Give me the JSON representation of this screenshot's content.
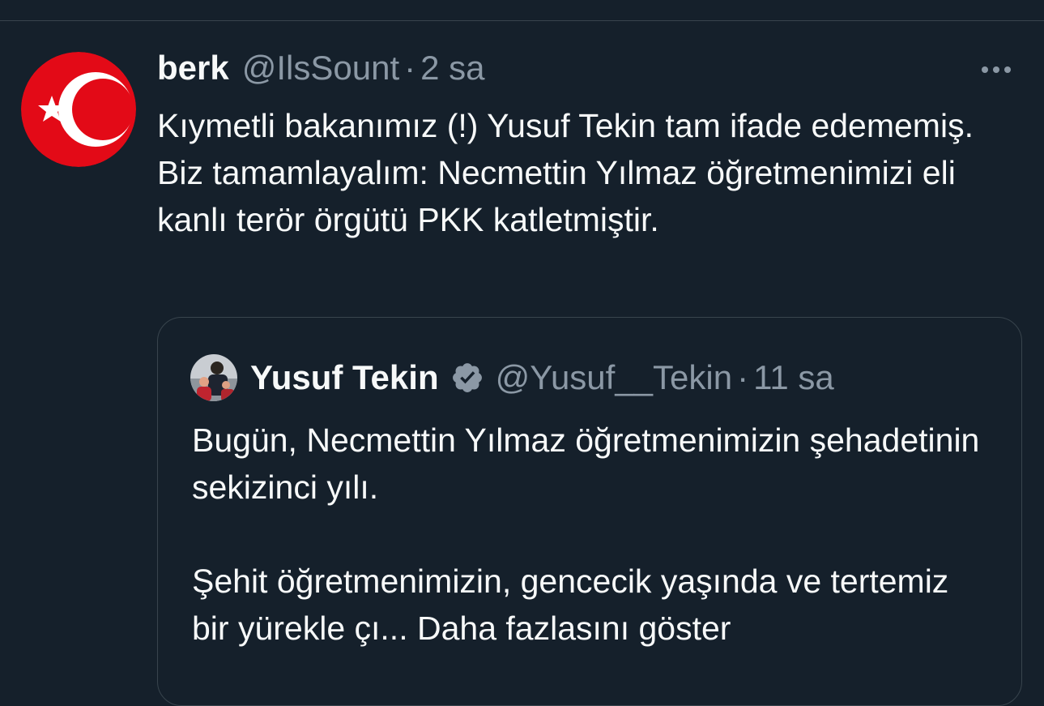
{
  "tweet": {
    "author_name": "berk",
    "author_handle": "@IlsSount",
    "separator": "·",
    "time": "2 sa",
    "text": "Kıymetli bakanımız (!) Yusuf Tekin tam ifade edememiş. Biz tamamlayalım: Necmettin Yılmaz öğretmenimizi eli kanlı terör örgütü PKK katletmiştir.",
    "avatar_icon": "turkish-flag-icon",
    "colors": {
      "avatar_red": "#e30a17",
      "background": "#15202b",
      "border": "#38444d",
      "secondary_text": "#8b98a5"
    }
  },
  "quote": {
    "author_name": "Yusuf Tekin",
    "author_handle": "@Yusuf__Tekin",
    "separator": "·",
    "time": "11 sa",
    "verified_icon": "verified-badge-icon",
    "text_p1": "Bugün, Necmettin Yılmaz öğretmenimizin şehadetinin sekizinci yılı.",
    "text_p2": "Şehit öğretmenimizin, gencecik yaşında ve tertemiz bir yürekle çı...",
    "show_more": "Daha fazlasını göster"
  },
  "more_icon": "more-options-icon"
}
